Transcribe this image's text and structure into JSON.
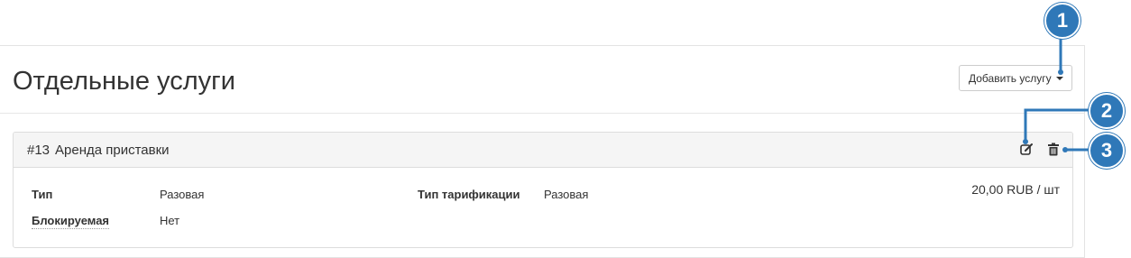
{
  "header": {
    "title": "Отдельные услуги",
    "add_button_label": "Добавить услугу"
  },
  "service": {
    "number": "#13",
    "name": "Аренда приставки",
    "fields": {
      "type_label": "Тип",
      "type_value": "Разовая",
      "blocking_label": "Блокируемая",
      "blocking_value": "Нет",
      "billing_label": "Тип тарификации",
      "billing_value": "Разовая"
    },
    "price": "20,00 RUB / шт"
  },
  "icons": {
    "edit": "edit-icon",
    "delete": "trash-icon",
    "dropdown": "caret-down-icon"
  },
  "callouts": [
    "1",
    "2",
    "3"
  ],
  "colors": {
    "callout": "#2f78b8",
    "card_header_bg": "#f5f5f5",
    "border": "#dddddd"
  }
}
